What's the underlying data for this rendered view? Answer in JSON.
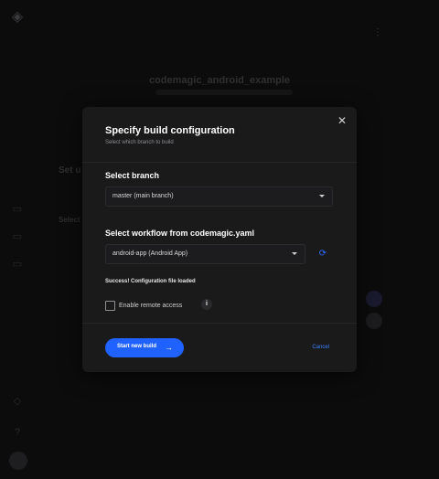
{
  "background": {
    "app_title": "codemagic_android_example",
    "setup_heading": "Set u",
    "select_heading": "Select"
  },
  "modal": {
    "title": "Specify build configuration",
    "subtitle": "Select which branch to build",
    "branch_section_label": "Select branch",
    "branch_value": "master (main branch)",
    "workflow_section_label": "Select workflow from codemagic.yaml",
    "workflow_value": "android-app (Android App)",
    "success_message": "Success! Configuration file loaded",
    "remote_access_label": "Enable remote access",
    "remote_access_checked": false,
    "start_button_label": "Start new build",
    "cancel_label": "Cancel"
  },
  "icons": {
    "close": "close-icon",
    "caret": "chevron-down-icon",
    "refresh": "refresh-icon",
    "info": "info-icon",
    "arrow": "arrow-right-icon",
    "logo": "codemagic-logo"
  },
  "colors": {
    "accent": "#1f62ff",
    "link": "#3b82ff",
    "modal_bg": "#1a1a1b",
    "page_bg": "#0c0c0d"
  }
}
